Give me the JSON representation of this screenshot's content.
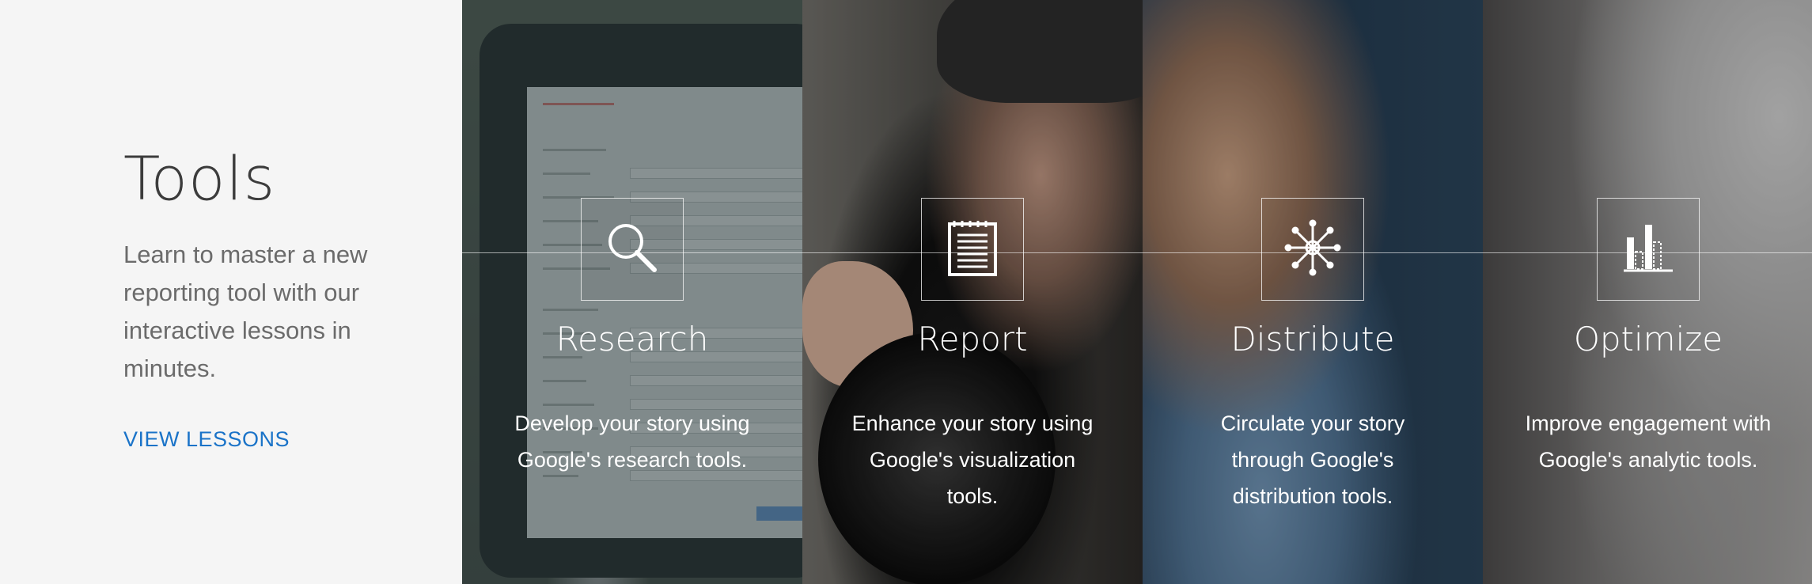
{
  "intro": {
    "title": "Tools",
    "description": "Learn to master a new reporting tool with our interactive lessons in minutes.",
    "link_label": "VIEW LESSONS",
    "link_color": "#1a73c8"
  },
  "tools": [
    {
      "icon": "search-icon",
      "name": "Research",
      "description": "Develop your story using Google's research tools."
    },
    {
      "icon": "document-icon",
      "name": "Report",
      "description": "Enhance your story using Google's visualization tools."
    },
    {
      "icon": "network-icon",
      "name": "Distribute",
      "description": "Circulate your story through Google's distribution tools."
    },
    {
      "icon": "bar-chart-icon",
      "name": "Optimize",
      "description": "Improve engagement with Google's analytic tools."
    }
  ]
}
